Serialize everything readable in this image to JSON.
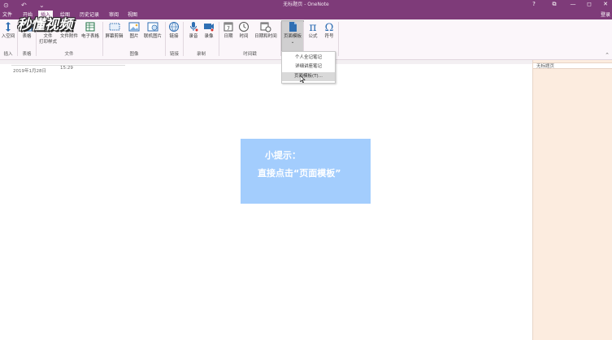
{
  "titlebar": {
    "title": "无标题页 - OneNote",
    "back_icon": "back-circle-icon",
    "undo_icon": "undo-icon",
    "help": "?",
    "restore": "⧉",
    "minimize": "—",
    "maximize": "◻",
    "close": "✕"
  },
  "tabs": [
    {
      "label": "文件"
    },
    {
      "label": "开始"
    },
    {
      "label": "插入"
    },
    {
      "label": "绘图"
    },
    {
      "label": "历史记录"
    },
    {
      "label": "审阅"
    },
    {
      "label": "视图"
    }
  ],
  "signin": "登录",
  "ribbon": {
    "buttons": {
      "insert_space": "入空间",
      "table": "表格",
      "file_printout": "文件",
      "file_printout2": "打印样式",
      "file_attachment": "文件附件",
      "spreadsheet": "电子表格",
      "screen_clipping": "屏幕剪辑",
      "pictures": "图片",
      "online_pictures": "联机图片",
      "link": "链接",
      "record_audio": "录音",
      "record_video": "录像",
      "date": "日期",
      "time": "时间",
      "date_time": "日期和时间",
      "page_templates": "页面模板",
      "equation": "公式",
      "symbol": "符号"
    },
    "groups": {
      "insert": "插入",
      "tables": "表格",
      "files": "文件",
      "images": "图像",
      "links": "链接",
      "recording": "录制",
      "timestamp": "时间戳"
    }
  },
  "dropdown": {
    "items": [
      {
        "label": "个人全记笔记"
      },
      {
        "label": "详细讲座笔记"
      },
      {
        "label": "页面模板(T)..."
      }
    ]
  },
  "page": {
    "date": "2019年1月28日",
    "time": "15:29"
  },
  "right_pane": {
    "page_item": "无标题页"
  },
  "hint": {
    "line1": "小提示：",
    "line2": "直接点击“页面模板”"
  },
  "watermark": {
    "text": "秒懂视频"
  },
  "colors": {
    "brand": "#7e3b79",
    "ribbon_bg": "#fbf6fa",
    "right_pane_bg": "#fcecdf",
    "hint_bg": "#a3cdfd",
    "icon_blue": "#2f6fb3"
  }
}
